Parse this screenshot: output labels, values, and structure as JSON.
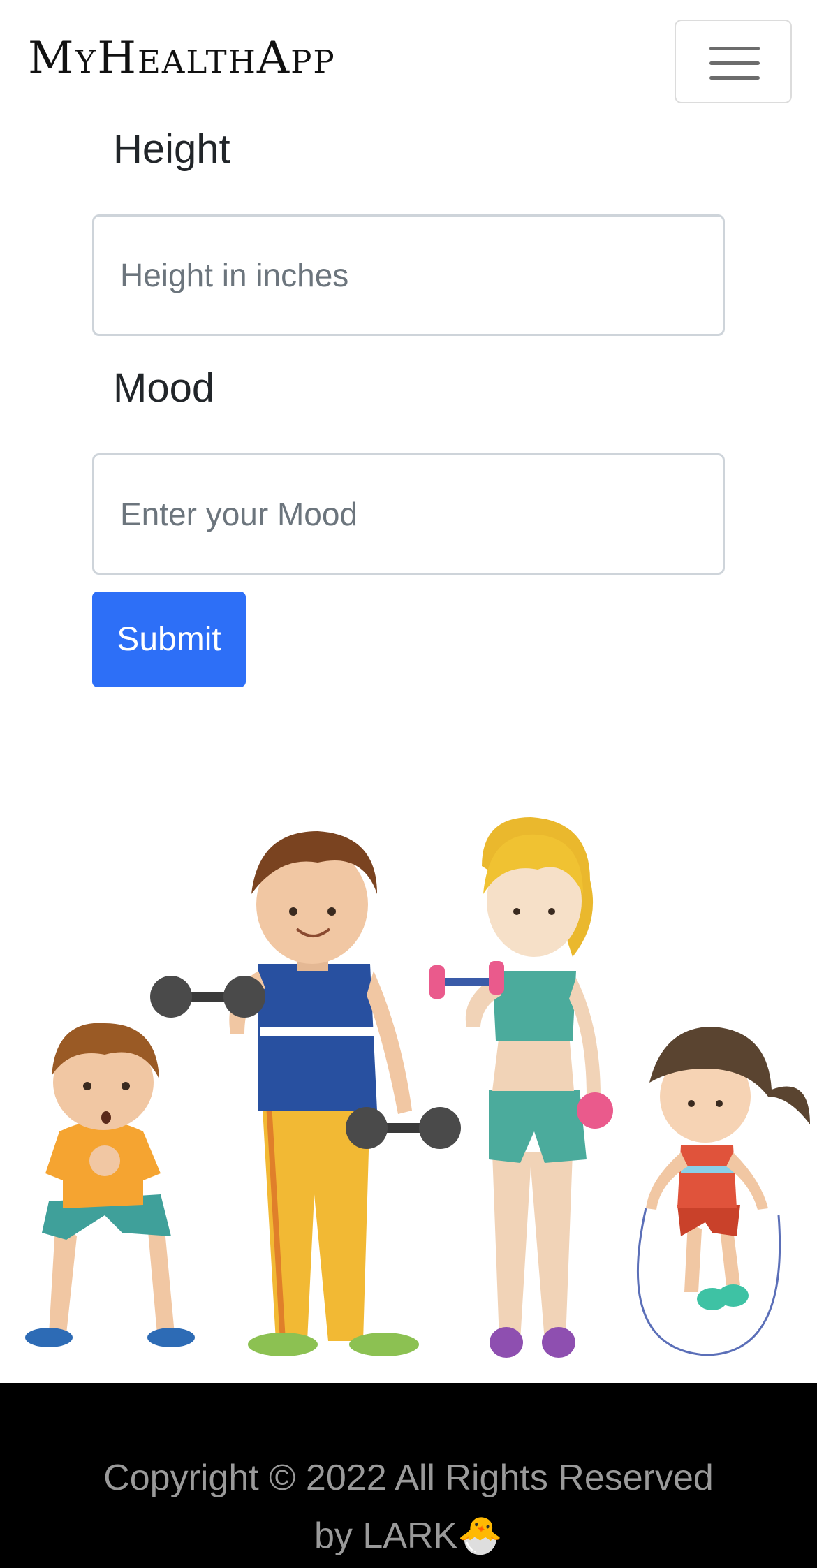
{
  "navbar": {
    "brand": "MyHealthApp",
    "menu_icon": "hamburger-menu-icon"
  },
  "form": {
    "height_label": "Height",
    "height_placeholder": "Height in inches",
    "mood_label": "Mood",
    "mood_placeholder": "Enter your Mood",
    "submit_label": "Submit"
  },
  "illustration": {
    "subject": "family-exercising-illustration"
  },
  "footer": {
    "line1": "Copyright © 2022 All Rights Reserved",
    "line2": "by LARK",
    "emoji": "🐣"
  },
  "colors": {
    "primary": "#2d6ff7",
    "footer_bg": "#000000",
    "footer_text": "#9a9a9a"
  }
}
